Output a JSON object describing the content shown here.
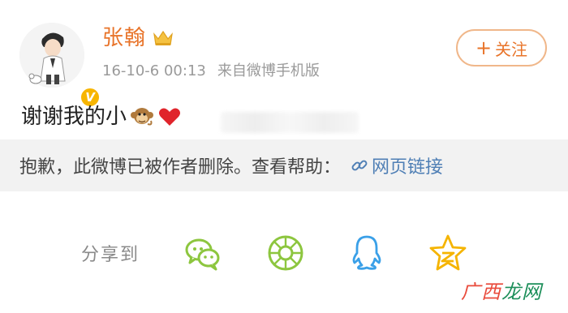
{
  "post": {
    "username": "张翰",
    "timestamp": "16-10-6 00:13",
    "source": "来自微博手机版",
    "text": "谢谢我的小",
    "emoji": [
      "monkey",
      "red-heart"
    ]
  },
  "follow": {
    "plus": "+",
    "label": "关注"
  },
  "deleted": {
    "message": "抱歉，此微博已被作者删除。查看帮助：",
    "link_label": "网页链接"
  },
  "share": {
    "label": "分享到",
    "targets": [
      "wechat-icon",
      "moments-icon",
      "qq-icon",
      "qzone-icon"
    ]
  },
  "watermark": {
    "part1": "广西",
    "part2": "龙网"
  },
  "colors": {
    "username": "#e8742a",
    "follow_border": "#f0b78a",
    "link": "#4f7fb5",
    "share_icon": "#8dc63f",
    "qq_icon": "#3aa0e8",
    "qzone_icon": "#f5b400",
    "verified_badge": "#f7b500",
    "watermark_red": "#e94b3c",
    "watermark_green": "#1d8f5a"
  }
}
